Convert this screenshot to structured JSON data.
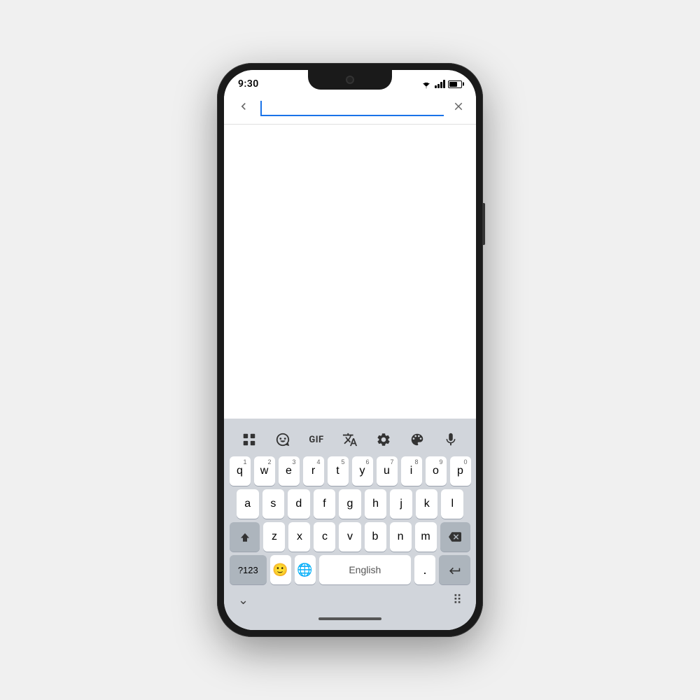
{
  "phone": {
    "status_bar": {
      "time": "9:30"
    },
    "search_bar": {
      "back_label": "‹",
      "close_label": "✕"
    },
    "keyboard": {
      "toolbar": {
        "items": [
          "apps",
          "sticker",
          "gif",
          "translate",
          "settings",
          "palette",
          "mic"
        ]
      },
      "row1": [
        {
          "key": "q",
          "num": "1"
        },
        {
          "key": "w",
          "num": "2"
        },
        {
          "key": "e",
          "num": "3"
        },
        {
          "key": "r",
          "num": "4"
        },
        {
          "key": "t",
          "num": "5"
        },
        {
          "key": "y",
          "num": "6"
        },
        {
          "key": "u",
          "num": "7"
        },
        {
          "key": "i",
          "num": "8"
        },
        {
          "key": "o",
          "num": "9"
        },
        {
          "key": "p",
          "num": "0"
        }
      ],
      "row2": [
        {
          "key": "a"
        },
        {
          "key": "s"
        },
        {
          "key": "d"
        },
        {
          "key": "f"
        },
        {
          "key": "g"
        },
        {
          "key": "h"
        },
        {
          "key": "j"
        },
        {
          "key": "k"
        },
        {
          "key": "l"
        }
      ],
      "row3": [
        {
          "key": "shift"
        },
        {
          "key": "z"
        },
        {
          "key": "x"
        },
        {
          "key": "c"
        },
        {
          "key": "v"
        },
        {
          "key": "b"
        },
        {
          "key": "n"
        },
        {
          "key": "m"
        },
        {
          "key": "delete"
        }
      ],
      "row4": {
        "sym_label": "?123",
        "emoji_label": "🙂",
        "globe_label": "🌐",
        "space_label": "English",
        "period_label": ".",
        "enter_label": "⏎"
      }
    },
    "bottom": {
      "chevron": "⌄",
      "dots": "⠿"
    }
  }
}
